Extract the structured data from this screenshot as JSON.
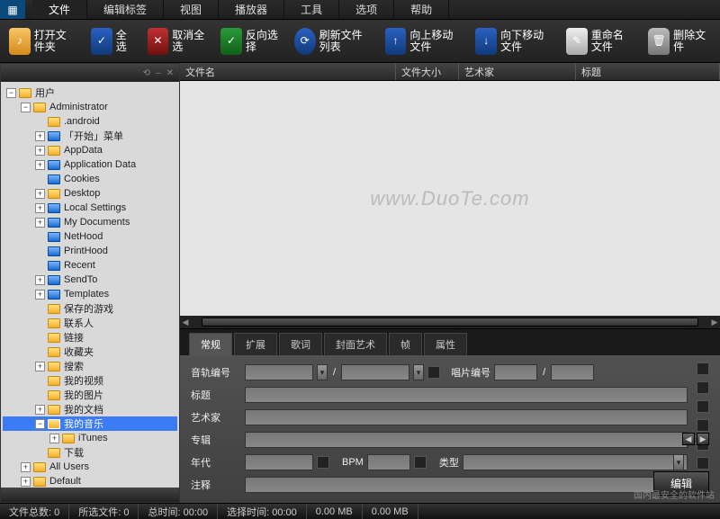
{
  "menu": {
    "items": [
      "文件",
      "编辑标签",
      "视图",
      "播放器",
      "工具",
      "选项",
      "帮助"
    ],
    "active_index": 0
  },
  "toolbar": {
    "open_folder": "打开文件夹",
    "select_all": "全选",
    "deselect_all": "取消全选",
    "invert_selection": "反向选择",
    "refresh_list": "刷新文件列表",
    "move_up": "向上移动文件",
    "move_down": "向下移动文件",
    "rename": "重命名文件",
    "delete": "删除文件"
  },
  "columns": {
    "filename": "文件名",
    "filesize": "文件大小",
    "artist": "艺术家",
    "title": "标题"
  },
  "tree": {
    "root": "用户",
    "items": [
      {
        "indent": 1,
        "exp": "-",
        "label": "Administrator",
        "blue": false,
        "lock": true
      },
      {
        "indent": 2,
        "exp": "",
        "label": ".android",
        "blue": false
      },
      {
        "indent": 2,
        "exp": "+",
        "label": "「开始」菜单",
        "blue": true
      },
      {
        "indent": 2,
        "exp": "+",
        "label": "AppData",
        "blue": false
      },
      {
        "indent": 2,
        "exp": "+",
        "label": "Application Data",
        "blue": true
      },
      {
        "indent": 2,
        "exp": "",
        "label": "Cookies",
        "blue": true
      },
      {
        "indent": 2,
        "exp": "+",
        "label": "Desktop",
        "blue": false
      },
      {
        "indent": 2,
        "exp": "+",
        "label": "Local Settings",
        "blue": true
      },
      {
        "indent": 2,
        "exp": "+",
        "label": "My Documents",
        "blue": true
      },
      {
        "indent": 2,
        "exp": "",
        "label": "NetHood",
        "blue": true
      },
      {
        "indent": 2,
        "exp": "",
        "label": "PrintHood",
        "blue": true
      },
      {
        "indent": 2,
        "exp": "",
        "label": "Recent",
        "blue": true
      },
      {
        "indent": 2,
        "exp": "+",
        "label": "SendTo",
        "blue": true
      },
      {
        "indent": 2,
        "exp": "+",
        "label": "Templates",
        "blue": true
      },
      {
        "indent": 2,
        "exp": "",
        "label": "保存的游戏",
        "blue": false
      },
      {
        "indent": 2,
        "exp": "",
        "label": "联系人",
        "blue": false
      },
      {
        "indent": 2,
        "exp": "",
        "label": "链接",
        "blue": false
      },
      {
        "indent": 2,
        "exp": "",
        "label": "收藏夹",
        "blue": false
      },
      {
        "indent": 2,
        "exp": "+",
        "label": "搜索",
        "blue": false
      },
      {
        "indent": 2,
        "exp": "",
        "label": "我的视频",
        "blue": false
      },
      {
        "indent": 2,
        "exp": "",
        "label": "我的图片",
        "blue": false
      },
      {
        "indent": 2,
        "exp": "+",
        "label": "我的文档",
        "blue": false
      },
      {
        "indent": 2,
        "exp": "-",
        "label": "我的音乐",
        "blue": false,
        "selected": true
      },
      {
        "indent": 3,
        "exp": "+",
        "label": "iTunes",
        "blue": false
      },
      {
        "indent": 2,
        "exp": "",
        "label": "下载",
        "blue": false
      },
      {
        "indent": 1,
        "exp": "+",
        "label": "All Users",
        "blue": false,
        "lock": true
      },
      {
        "indent": 1,
        "exp": "+",
        "label": "Default",
        "blue": false,
        "lock": true
      }
    ]
  },
  "tabs": {
    "items": [
      "常规",
      "扩展",
      "歌词",
      "封面艺术",
      "帧",
      "属性"
    ],
    "active_index": 0
  },
  "form": {
    "track_no": "音轨编号",
    "disc_no": "唱片编号",
    "title": "标题",
    "artist": "艺术家",
    "album": "专辑",
    "year": "年代",
    "bpm": "BPM",
    "genre": "类型",
    "comment": "注释",
    "edit_btn": "编辑"
  },
  "status": {
    "total_files": "文件总数: 0",
    "selected_files": "所选文件: 0",
    "total_time": "总时间: 00:00",
    "selected_time": "选择时间: 00:00",
    "size1": "0.00 MB",
    "size2": "0.00 MB",
    "credit": "国内最安全的软件站"
  },
  "watermark": "www.DuoTe.com"
}
